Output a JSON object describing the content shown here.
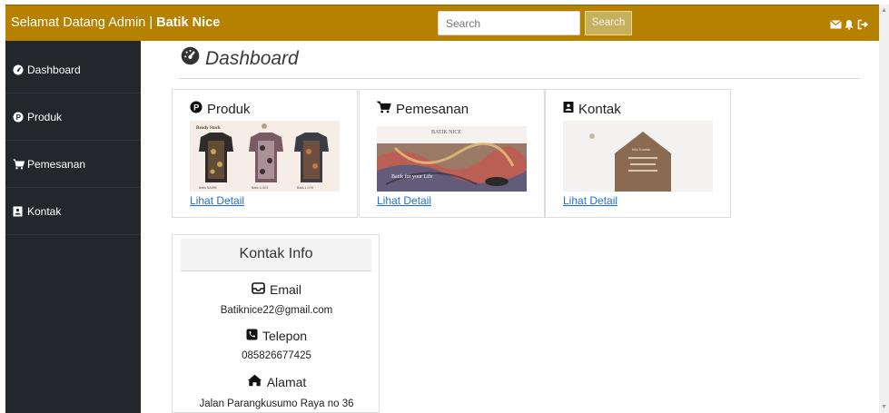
{
  "navbar": {
    "welcome": "Selamat Datang Admin | ",
    "brand": "Batik Nice",
    "search_placeholder": "Search",
    "search_button": "Search",
    "icons": [
      "envelope-icon",
      "bell-icon",
      "sign-out-icon"
    ]
  },
  "sidebar": {
    "items": [
      {
        "label": "Dashboard",
        "icon": "tachometer-icon"
      },
      {
        "label": "Produk",
        "icon": "product-circle-icon"
      },
      {
        "label": "Pemesanan",
        "icon": "cart-icon"
      },
      {
        "label": "Kontak",
        "icon": "contact-book-icon"
      }
    ]
  },
  "main": {
    "title": "Dashboard",
    "cards": [
      {
        "title": "Produk",
        "link": "Lihat Detail",
        "icon": "product-circle-icon"
      },
      {
        "title": "Pemesanan",
        "link": "Lihat Detail",
        "icon": "cart-icon"
      },
      {
        "title": "Kontak",
        "link": "Lihat Detail",
        "icon": "contact-book-icon"
      }
    ],
    "thumbs": {
      "produk": {
        "heading": "Ready Stock",
        "captions": [
          "Batik NA998",
          "Batik LJ103",
          "Batik LJ176"
        ]
      },
      "pemesanan": {
        "heading": "BATIK NICE",
        "caption": "Batik for your Life"
      },
      "kontak": {
        "heading": "Info Kontak"
      }
    }
  },
  "contact": {
    "title": "Kontak Info",
    "email_label": "Email",
    "email": "Batiknice22@gmail.com",
    "phone_label": "Telepon",
    "phone": "085826677425",
    "address_label": "Alamat",
    "address": "Jalan Parangkusumo Raya no 36"
  },
  "colors": {
    "navbar": "#b78100",
    "sidebar": "#23272b",
    "search_button": "#c5b15d",
    "link": "#1e6fd9"
  }
}
